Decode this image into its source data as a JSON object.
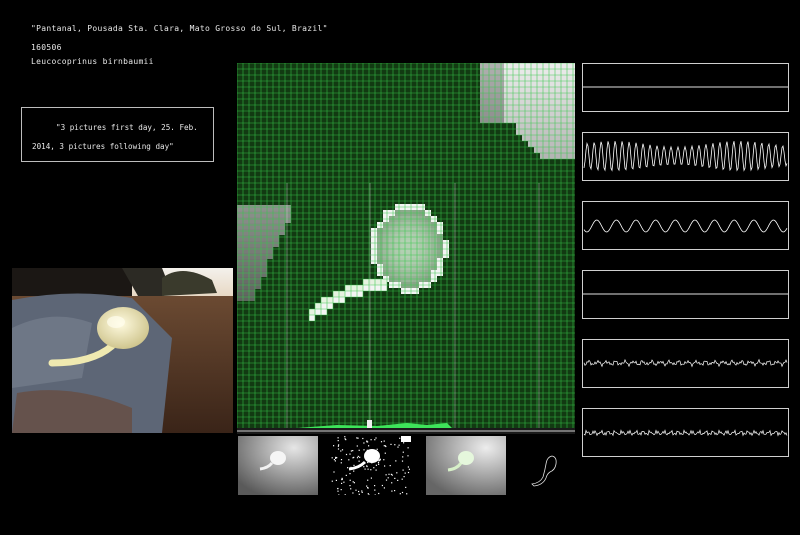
{
  "header": {
    "location": "\"Pantanal, Pousada Sta. Clara, Mato Grosso do Sul, Brazil\"",
    "specimen_id": "160506",
    "species": "Leucocoprinus birnbaumii"
  },
  "note": {
    "text": "\"3 pictures first day, 25. Feb. 2014, 3 pictures following day\""
  },
  "colors": {
    "background": "#000000",
    "grid_green": "#2bbf3c",
    "text": "#e8e8e8",
    "frame": "#cfcfcf"
  },
  "signal_panels": [
    {
      "name": "signal-flat-1",
      "pattern": "flat"
    },
    {
      "name": "signal-dense-oscillation",
      "pattern": "dense"
    },
    {
      "name": "signal-wave",
      "pattern": "wave"
    },
    {
      "name": "signal-flat-2",
      "pattern": "flat"
    },
    {
      "name": "signal-noise-1",
      "pattern": "noise"
    },
    {
      "name": "signal-noise-2",
      "pattern": "noise"
    }
  ],
  "thumbnails": [
    {
      "name": "thumb-grayscale",
      "style": "gray"
    },
    {
      "name": "thumb-binary",
      "style": "binary"
    },
    {
      "name": "thumb-grayscale-2",
      "style": "gray"
    },
    {
      "name": "thumb-outline",
      "style": "outline"
    }
  ]
}
